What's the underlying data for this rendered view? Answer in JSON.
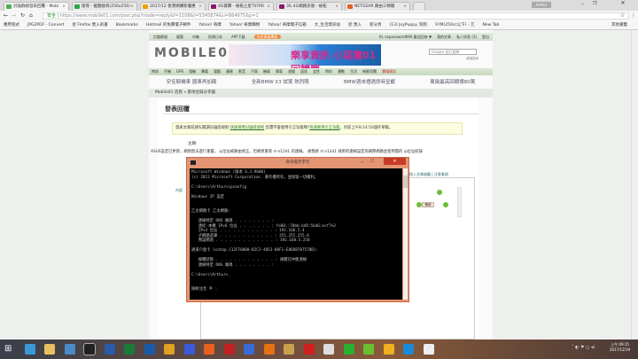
{
  "browser": {
    "tabs": [
      {
        "label": "討論群組發表回覆 - Mobi",
        "color": "#4caf50"
      },
      {
        "label": "搜尋 - 截圖搜尋(256x256)",
        "color": "#2aa84a"
      },
      {
        "label": "2017/12 香港網購新優惠",
        "color": "#f2a000"
      },
      {
        "label": "4G資費 - 被拓之星TSTAR",
        "color": "#8a1a6a"
      },
      {
        "label": "3G.4G網路訊號 - 被拓",
        "color": "#8a1a6a"
      },
      {
        "label": "NETGEAR 路由三頻驗",
        "color": "#e06020"
      }
    ],
    "user_badge": "Arthur",
    "url_secure": "安全",
    "url": "https://www.mobile01.com/post.php?mode=reply&f=1108&t=5345874&u=864675&p=1",
    "bookmarks": [
      "應用程式",
      "JPG2PDF - Convert",
      "從 Firefox 匯入的書",
      "Bookmarks",
      "Hotmail 的免費電子郵件",
      "Yahoo! 奇摩",
      "Yahoo! 奇摩購物",
      "Yahoo! 奇摩電子信箱",
      "大_生活資訊站",
      "從 匯入",
      "新分頁",
      "(13) JoyPuppy. 狗狗",
      "SYM(250cc以下) - 兀",
      "New Tab",
      "其他書籤"
    ]
  },
  "site": {
    "topnav": [
      "討論群組",
      "優惠",
      "市集",
      "投資日本",
      "APP下載",
      "台北車展專區"
    ],
    "user_menu": [
      "Hi, ezpassword666 歡迎回來 ▼",
      "我的文章",
      "私人訊息 (3)",
      "登出"
    ],
    "logo": "MOBILE01",
    "banner": "樂享資訊 小惡魔01 回饋慶",
    "search_placeholder": "Google 自訂搜尋",
    "advanced_search": "進階搜尋",
    "categories": [
      "時尚",
      "手機",
      "GPS",
      "相機",
      "筆電",
      "電腦",
      "蘋果",
      "影音",
      "汽車",
      "機車",
      "單車",
      "遊戲",
      "居家",
      "女性",
      "時尚",
      "運動",
      "生活",
      "新鮮奇聞",
      "賣場資訊"
    ],
    "promos": [
      "安佳騎機車 國車再加碼",
      "全新BMW X3 試駕 熱烈限",
      "BMW週末禮遇即時呈獻",
      "東風最高回饋價80萬"
    ],
    "breadcrumb": "Mobile01 首頁 » 基地台與分享器",
    "page_title": "發表回覆",
    "notice": {
      "pre": "發表文章前請先閱讀討論區規則:",
      "link1": "快速搜尋討論區規則",
      "mid": "您還不會使用引言功能嗎?",
      "link2": "快速搜尋引言功能",
      "post": "。目前上午8:14:50儲存草稿。"
    },
    "subject_label": "主題:",
    "subject": "ASUS設定已更新，網頁無法進行重置。 ip位址被路由修正。但網頁重新 rt-n12d1 的連線。 故我將 rt-n12d1 採用的連線設定為網際網路並使用開的 ip位址紀錄",
    "right_links": "插入文章縮圖 | 注意事項",
    "left_label": "內容",
    "send_label": "確認"
  },
  "cmd": {
    "title": "命令提示字元",
    "lines": [
      "Microsoft Windows [版本 6.3.9600]",
      "(c) 2013 Microsoft Corporation. 著作權所有，並保留一切權利。",
      "",
      "C:\\Users\\Arthur>ipconfig",
      "",
      "Windows IP 設定",
      "",
      "",
      "乙太網路卡 乙太網路:",
      "",
      "   連線特定 DNS 尾碼 . . . . . . . . :",
      "   連結-本機 IPv6 位址 . . . . . . . : fe80::78bb:b49:5b46:ecf7%3",
      "   IPv4 位址 . . . . . . . . . . . . : 192.168.5.4",
      "   子網路遮罩 . . . . . . . . . . . . : 255.255.255.0",
      "   預設閘道 . . . . . . . . . . . . . : 192.168.5.250",
      "",
      "通道介面卡 isatap.{12FF8000-B2C3-4053-88F1-E8688787578B}:",
      "",
      "   媒體狀態 . . . . . . . . . . . . . : 媒體已中斷連線",
      "   連線特定 DNS 尾碼 . . . . . . . . :",
      "",
      "C:\\Users\\Arthur>_",
      "",
      "",
      "微軟注音 半 :"
    ]
  },
  "taskbar": {
    "icons": [
      "start",
      "edge",
      "file-explorer",
      "control-panel",
      "cmd",
      "word",
      "excel",
      "outlook",
      "chrome",
      "app-blue",
      "firefox",
      "app-red",
      "app-blue2",
      "vlc",
      "app-media",
      "opera",
      "app-robot",
      "line",
      "wechat",
      "app-yellow",
      "skype",
      "app-mahjong"
    ],
    "time": "上午 09:15",
    "date": "2017/12/19"
  }
}
